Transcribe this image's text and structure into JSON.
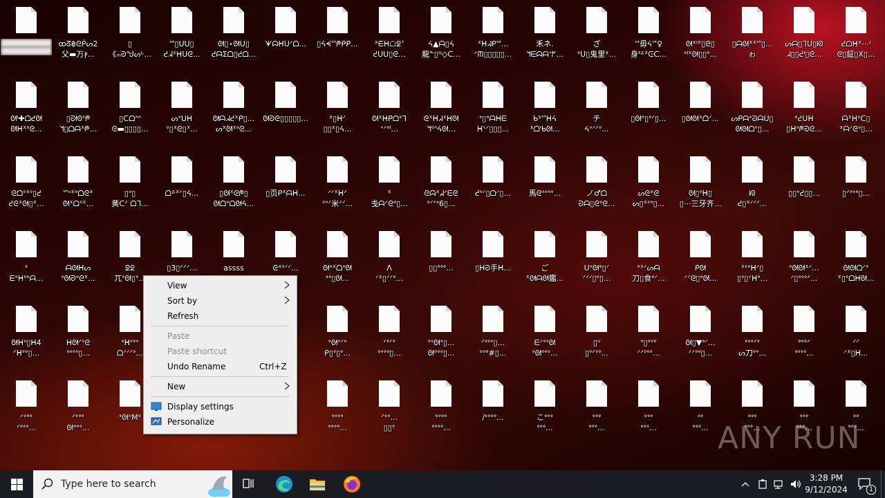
{
  "desktop": {
    "rows": [
      [
        {
          "l1": "",
          "l2": "",
          "blurred": true
        },
        {
          "l1": "ꝏᘔ฿ᘓᑮᔕ2",
          "l2": "父▬万ⳁ..."
        },
        {
          "l1": "▯",
          "l2": "《ₘᘒᖑᔕᒡ..."
        },
        {
          "l1": "ᔥ▯ᑌᑌ▯",
          "l2": "ᕍᖽᕽᕼᑌᘓ..."
        },
        {
          "l1": "ᘛ▯⋆ᘛᑌ▯",
          "l2": "ᕍᗩΣᗝ▯ᕍᗝ..."
        },
        {
          "l1": "ᗖᗣᕼᑌᐟᗝ...",
          "l2": ""
        },
        {
          "l1": "▯ᔦᗕᔥᖘᑭᑭ...",
          "l2": ""
        },
        {
          "l1": "ᕽᗴᕼ☖ᘖᐪ",
          "l2": "ᕍᑌᑌ▯ᘓ..."
        },
        {
          "l1": "ᔦ▲ᗩ▯ᔦ",
          "l2": "龍ᓐ▯ᓑ◇ᑕ..."
        },
        {
          "l1": "ᕽᕼᖽᑭᔥ...",
          "l2": "ᐟᙏ▯▯▯▯▯..."
        },
        {
          "l1": "禾ネ.",
          "l2": "ᖿᗴᗣᗩᐩᖼ..."
        },
        {
          "l1": "ざ",
          "l2": "ᐤᑌ▯鬼里ᕽ..."
        },
        {
          "l1": "ᔥ毋ᔦᔥ♀",
          "l2": "身ᓫᐞᕽᕮᑕ..."
        },
        {
          "l1": "ᘛᕽᑊᕽ▯ᘓ▯",
          "l2": "ᐤᑊᕽᘛ▯▯ᐤ..."
        },
        {
          "l1": "▯ᗩᘛᕽᕽᔥ▯...",
          "l2": "ゎ"
        },
        {
          "l1": "ᔕᗩ▯ᒣᑌ▯ᘗ",
          "l2": "ᖽ▯▯ᕍᑊ▯ᘓ..."
        },
        {
          "l1": "ᕍᗝᕼᕽ⋯ᑊ",
          "l2": "ᘓ▯鉦▯X▯..."
        }
      ],
      [
        {
          "l1": "ᘛᑊ✚ᗝᕍᘛ",
          "l2": "ᘛᕼᕽᐤᘓ..."
        },
        {
          "l1": "▯ᘒᘚᐤᖘ",
          "l2": "ᖿ▯ᗝᗩᕽᖘ..."
        },
        {
          "l1": "▯ᑕᗝᐢᐢ",
          "l2": "ᘓ▬▯▯▯▯..."
        },
        {
          "l1": "ᔕᐤᑌᕼ",
          "l2": "ᐡ▯ᕽᘓ▯ᕽ..."
        },
        {
          "l1": "ᘛᗩᖽᕍᕽᑭ▯...",
          "l2": "ᔕᕽᘛᕽᐤᘓ..."
        },
        {
          "l1": "ᘛᘒᘓ▯▯▯▯▯...",
          "l2": ""
        },
        {
          "l1": "ᕽ▯ᕼᐟ",
          "l2": "▯▯ᕽ▯ᔦ..."
        },
        {
          "l1": "ᘛᕽᕼᑭᗝᐤᒣ",
          "l2": "ᐩᐟᐤᑊ..."
        },
        {
          "l1": "ᘓᕽᕼᖽᕽᕼᘛ",
          "l2": "ᖿᐤᐢᔦᘛ..."
        },
        {
          "l1": "ᐤ▯ᐤᗩᕼᗴ",
          "l2": "ᕼᐠᐟ▯▯▯..."
        },
        {
          "l1": "ᑲᔆᔥᕼᔦ",
          "l2": "ᕽᗝᑊᑲᘛ..."
        },
        {
          "l1": "チ",
          "l2": "ᔦᐡᐟᐟᐤ..."
        },
        {
          "l1": "▯ᘛᐤ▯ᐤᐟ▯...",
          "l2": ""
        },
        {
          "l1": "▯ᘛᘛᕽᗝᐟ...",
          "l2": ""
        },
        {
          "l1": "ᔕᑭᗩᐤᘒᗩᑌ▯",
          "l2": "ᘛᘛᗝᐤ▯..."
        },
        {
          "l1": "ᐤᕍᑌᕼ",
          "l2": "▯ᕼᐤᖘᘒᘓ..."
        },
        {
          "l1": "ᗩᕽᕼᐤᑕ▯",
          "l2": "ᕽᗩᐟᘓᐤ▯..."
        }
      ],
      [
        {
          "l1": "ᘓᗝᐤᕽᐤ▯ᕍ",
          "l2": "ᕍᘓᕽᘛ▯ᕽ..."
        },
        {
          "l1": "ᔥᐡᕽᐤᗝᘓᕽ",
          "l2": "ᘛᕽᗝᐤᕽ..."
        },
        {
          "l1": "▯ᐤ▯",
          "l2": "黄ᑕᐟ ᗝᒣ..."
        },
        {
          "l1": "ᗝᐞᕽᐟ▯ᔦ...",
          "l2": ""
        },
        {
          "l1": "▯ᘛᕽᘓᖘ▯",
          "l2": "ᘛᗝᐤᗝᘛᔦ..."
        },
        {
          "l1": "▯页ᑭᕽᗩᕼ...",
          "l2": ""
        },
        {
          "l1": "ᐟᐟᕽᕼᐟ",
          "l2": "ᐤᐢᐟ米ᐟᐟ..."
        },
        {
          "l1": "ᕽ",
          "l2": "戋ᗩᐟᘓᐤ▯..."
        },
        {
          "l1": "ᘓᗣᕽᖽᐟᗴᘓ",
          "l2": "ᐤᐟᐩᐤ6▯..."
        },
        {
          "l1": "ᕍᐤᐟ▯ᗝᐟ▯...",
          "l2": ""
        },
        {
          "l1": "馬ᘓᐤᐤᐤᐤ...",
          "l2": ""
        },
        {
          "l1": "ノ♂ᗝ",
          "l2": "ᘒᗩ▯ᘓᐤᘓ..."
        },
        {
          "l1": "ᔕᘓᕽᘓ",
          "l2": "ᔕ▯ᕽᐤᐤ▯..."
        },
        {
          "l1": "ᘛ▯ᐤᕼ▯",
          "l2": "▯⋯三牙齐..."
        },
        {
          "l1": "ᘗ",
          "l2": "ᕍ▯ᕽᐟᐟᐟ..."
        },
        {
          "l1": "▯▯ᐤᕍ▯▯...",
          "l2": ""
        },
        {
          "l1": "▯ᐟᐤᐤᐤ▯...",
          "l2": ""
        }
      ],
      [
        {
          "l1": "ᐤ",
          "l2": "ᗴᐤᕼᐤᐤᗩ..."
        },
        {
          "l1": "ᗩᘛᕼᔕ",
          "l2": "ᐤᘛᘒᐤᘓᕽ..."
        },
        {
          "l1": "ᘖᘖ",
          "l2": "兀ᐢᘛ▯ᐤ..."
        },
        {
          "l1": "▯3▯ᐟᐟᐟ...",
          "l2": ""
        },
        {
          "l1": "assss",
          "l2": ""
        },
        {
          "l1": "ᘓᕽᐤᐟᐟ...",
          "l2": ""
        },
        {
          "l1": "ᘛᐤᕽᗝᐤᘛ",
          "l2": "ᐤᐤ▯ᘛ..."
        },
        {
          "l1": "ᐱ",
          "l2": "ᐟᕽ▯ᐟᐟᐤ..."
        },
        {
          "l1": "▯▯ᐤᐤᐤ...",
          "l2": ""
        },
        {
          "l1": "▯ᕼᘒ手ᕼ...",
          "l2": ""
        },
        {
          "l1": "ご",
          "l2": "ᕽᘛᗩᘛ鑑..."
        },
        {
          "l1": "ᑌᐤᘛᐤ▯ᐟ",
          "l2": "ᐟᐟᐟ▯ᐤ▯..."
        },
        {
          "l1": "ᐤᕽᐟᔕᗩ",
          "l2": "刀▯食ᐤᐟ..."
        },
        {
          "l1": "ᑭᘛ",
          "l2": "ᐟᐟᘓ▯ᐤᘛ..."
        },
        {
          "l1": "ᕽᐤᐤᕼᐟ▯",
          "l2": "▯ᐤ▯ᐟᕼᐤ..."
        },
        {
          "l1": "ᐤᘛᘛᕽᐟ...",
          "l2": "ᐟ▯ᐤᐤᐤᐟ..."
        },
        {
          "l1": "ᘛᘛᗝᐟᐤ",
          "l2": "ᕽ▯ᐤᗝᕼᘛ..."
        }
      ],
      [
        {
          "l1": "ᘛᕼᐤ▯ᕼ4",
          "l2": "ᐟᕼᐤᐤ▯..."
        },
        {
          "l1": "ᕼᘛᐟᐤᘓ",
          "l2": "ᐤᐤᐤᐤ▯..."
        },
        {
          "l1": "ᐤᕼᐤᐤᐤ",
          "l2": "ᗝᐟᐟᐟᐤ..."
        },
        {
          "l1": "",
          "l2": "",
          "hidden": true
        },
        {
          "l1": "",
          "l2": "",
          "hidden": true
        },
        {
          "l1": "",
          "l2": "",
          "hidden": true
        },
        {
          "l1": "ᐤᘛᐤᐟᐤ",
          "l2": "ᑭ▯ᐤ▯ᐤ..."
        },
        {
          "l1": "ᐟᐤᐟᐤ",
          "l2": "ᐤᐤᐤᐤ▯..."
        },
        {
          "l1": "ᐤᐤᘛᐤ▯...",
          "l2": "ᘛᐤᐤᐤ▯..."
        },
        {
          "l1": "ᐟᐤᐤᐤ▯...",
          "l2": "ᐤᐤᐤ#▯..."
        },
        {
          "l1": "ᗴᐟᐤᐤᘛ",
          "l2": "ᐤᘛᐤᐤᐤ..."
        },
        {
          "l1": "▯ᐡ",
          "l2": "▯ᐤᐟᐤᐤ..."
        },
        {
          "l1": "ᐤ▯ᐤᐤᐤ",
          "l2": "ᐟᐟᐤᐤᐤ..."
        },
        {
          "l1": "ᘛ▯▼ᐤᐟ...",
          "l2": "ᐟᐟᐤᐤ▯..."
        },
        {
          "l1": "ᐤᐤᐤᐟᐤ",
          "l2": "ᔕ刀ᐤᐤ..."
        },
        {
          "l1": "ᐤᐤᐤᐟ",
          "l2": "ᐤᐤᐤᐤ..."
        },
        {
          "l1": "ᐟᐟ",
          "l2": "ᐟᕽ▯ᕼ..."
        }
      ],
      [
        {
          "l1": "ᐟᐤᐤᐤ",
          "l2": "ᐟᐤᐤᐤ..."
        },
        {
          "l1": "ᐟᐤᐤᐤ",
          "l2": "ᘛᐤᐤᐤ..."
        },
        {
          "l1": "ᐤᘛᐤMᐤ",
          "l2": ""
        },
        {
          "l1": "",
          "l2": "",
          "hidden": true
        },
        {
          "l1": "",
          "l2": "",
          "hidden": true
        },
        {
          "l1": "",
          "l2": "",
          "hidden": true
        },
        {
          "l1": "ᐤᐤᐤᐤ",
          "l2": "ᐤᐤᐤᐤ..."
        },
        {
          "l1": "ᐟᐤᐤ...",
          "l2": "▯▯ᐤ"
        },
        {
          "l1": "ᐤᐤᐤᐤ",
          "l2": "ᐤᐤᐤᐤ..."
        },
        {
          "l1": "/ᐤᐤᐤᐤ...",
          "l2": ""
        },
        {
          "l1": "こᐤᐤᐤ",
          "l2": "ᐤᐤᐤ..."
        },
        {
          "l1": "ᐤᐤᐤ",
          "l2": "ᐤᐤᐤ..."
        },
        {
          "l1": "ᐤᐤᐤ",
          "l2": "ᐤᐤᐤ..."
        },
        {
          "l1": "ᐤᐤ",
          "l2": "ᐤᐤᐤ..."
        },
        {
          "l1": "ᐤᐤᐤ",
          "l2": "ᐤᐤᐤ..."
        },
        {
          "l1": "ᐤᐤᐤ",
          "l2": "ᐤᐤᐤ..."
        },
        {
          "l1": "ᐤᐤ",
          "l2": "ᐤᐤᐤ..."
        }
      ]
    ]
  },
  "context_menu": {
    "items": [
      {
        "label": "View",
        "submenu": true,
        "disabled": false
      },
      {
        "label": "Sort by",
        "submenu": true,
        "disabled": false
      },
      {
        "label": "Refresh",
        "disabled": false
      },
      {
        "label": "Paste",
        "disabled": true
      },
      {
        "label": "Paste shortcut",
        "disabled": true
      },
      {
        "label": "Undo Rename",
        "shortcut": "Ctrl+Z",
        "disabled": false
      },
      {
        "label": "New",
        "submenu": true,
        "disabled": false
      },
      {
        "label": "Display settings",
        "icon": "display-settings-icon",
        "disabled": false
      },
      {
        "label": "Personalize",
        "icon": "personalize-icon",
        "disabled": false
      }
    ]
  },
  "taskbar": {
    "search_placeholder": "Type here to search",
    "time": "3:28 PM",
    "date": "9/12/2024",
    "notification_count": "1",
    "apps": [
      "task-view-icon",
      "edge-icon",
      "file-explorer-icon",
      "firefox-icon"
    ]
  },
  "watermark": "ANY RUN",
  "colors": {
    "menu_bg": "#eeeeee",
    "taskbar_bg": "#1c1d22",
    "accent": "#0078d7"
  }
}
